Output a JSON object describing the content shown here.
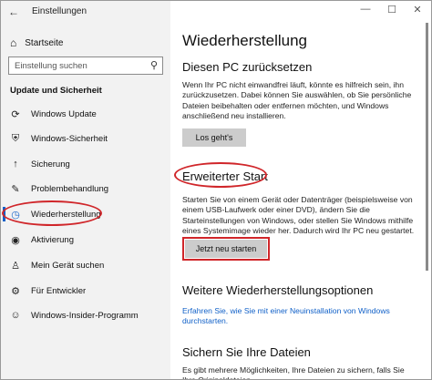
{
  "window": {
    "title": "Einstellungen",
    "controls": [
      "—",
      "☐",
      "✕"
    ]
  },
  "sidebar": {
    "home_label": "Startseite",
    "search_placeholder": "Einstellung suchen",
    "section_title": "Update und Sicherheit",
    "items": [
      {
        "label": "Windows Update",
        "icon": "sync-icon"
      },
      {
        "label": "Windows-Sicherheit",
        "icon": "shield-icon"
      },
      {
        "label": "Sicherung",
        "icon": "backup-arrow-icon"
      },
      {
        "label": "Problembehandlung",
        "icon": "wrench-icon"
      },
      {
        "label": "Wiederherstellung",
        "icon": "recovery-clock-icon",
        "active": true
      },
      {
        "label": "Aktivierung",
        "icon": "activation-check-icon"
      },
      {
        "label": "Mein Gerät suchen",
        "icon": "person-search-icon"
      },
      {
        "label": "Für Entwickler",
        "icon": "developer-icon"
      },
      {
        "label": "Windows-Insider-Programm",
        "icon": "insider-icon"
      }
    ]
  },
  "main": {
    "title": "Wiederherstellung",
    "reset": {
      "heading": "Diesen PC zurücksetzen",
      "text": "Wenn Ihr PC nicht einwandfrei läuft, könnte es hilfreich sein, ihn zurückzusetzen. Dabei können Sie auswählen, ob Sie persönliche Dateien beibehalten oder entfernen möchten, und Windows anschließend neu installieren.",
      "button": "Los geht's"
    },
    "advanced": {
      "heading": "Erweiterter Start",
      "text": "Starten Sie von einem Gerät oder Datenträger (beispielsweise von einem USB-Laufwerk oder einer DVD), ändern Sie die Starteinstellungen von Windows, oder stellen Sie Windows mithilfe eines Systemimage wieder her. Dadurch wird Ihr PC neu gestartet.",
      "button": "Jetzt neu starten"
    },
    "more": {
      "heading": "Weitere Wiederherstellungsoptionen",
      "link": "Erfahren Sie, wie Sie mit einer Neuinstallation von Windows durchstarten."
    },
    "backup": {
      "heading": "Sichern Sie Ihre Dateien",
      "text": "Es gibt mehrere Möglichkeiten, Ihre Dateien zu sichern, falls Sie Ihre Originaldateien"
    }
  },
  "colors": {
    "accent": "#1060c8",
    "highlight_red": "#d0262a",
    "sidebar_bg": "#f2f2f2"
  }
}
